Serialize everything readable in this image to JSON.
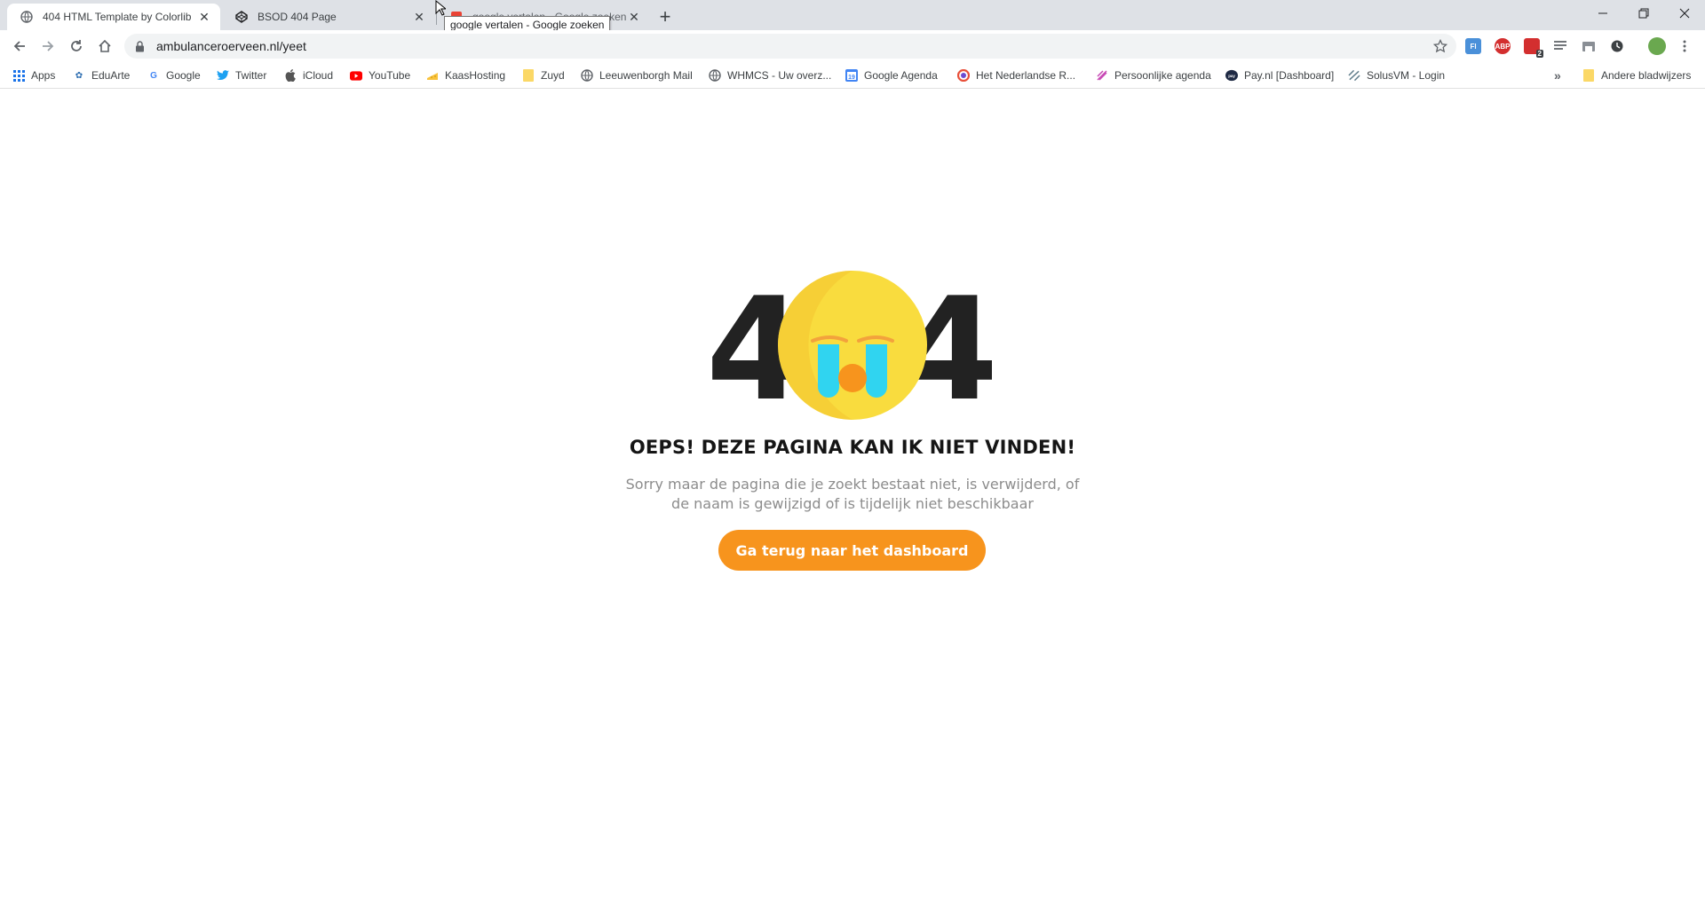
{
  "browser": {
    "tabs": [
      {
        "title": "404 HTML Template by Colorlib",
        "active": true
      },
      {
        "title": "BSOD 404 Page",
        "active": false
      },
      {
        "title": "google vertalen - Google zoeken",
        "active": false
      }
    ],
    "tooltip": "google vertalen - Google zoeken",
    "url": "ambulanceroerveen.nl/yeet",
    "extension_badge": "2",
    "window_controls": {
      "minimize": "–",
      "restore": "❐",
      "close": "✕"
    }
  },
  "bookmarks": {
    "items": [
      {
        "label": "Apps",
        "icon": "apps-grid-icon"
      },
      {
        "label": "EduArte",
        "icon": "eduarte-icon"
      },
      {
        "label": "Google",
        "icon": "google-icon"
      },
      {
        "label": "Twitter",
        "icon": "twitter-icon"
      },
      {
        "label": "iCloud",
        "icon": "apple-icon"
      },
      {
        "label": "YouTube",
        "icon": "youtube-icon"
      },
      {
        "label": "KaasHosting",
        "icon": "cheese-icon"
      },
      {
        "label": "Zuyd",
        "icon": "folder-icon"
      },
      {
        "label": "Leeuwenborgh Mail",
        "icon": "globe-icon"
      },
      {
        "label": "WHMCS - Uw overz...",
        "icon": "globe-icon"
      },
      {
        "label": "Google Agenda",
        "icon": "calendar-icon"
      },
      {
        "label": "Het Nederlandse R...",
        "icon": "red-cross-icon"
      },
      {
        "label": "Persoonlijke agenda",
        "icon": "agenda-icon"
      },
      {
        "label": "Pay.nl [Dashboard]",
        "icon": "paynl-icon"
      },
      {
        "label": "SolusVM - Login",
        "icon": "solusvm-icon"
      }
    ],
    "overflow": "»",
    "other_folder": "Andere bladwijzers"
  },
  "page": {
    "digit_left": "4",
    "digit_right": "4",
    "headline": "OEPS! DEZE PAGINA KAN IK NIET VINDEN!",
    "description": "Sorry maar de pagina die je zoekt bestaat niet, is verwijderd, of de naam is gewijzigd of is tijdelijk niet beschikbaar",
    "button_label": "Ga terug naar het dashboard"
  },
  "colors": {
    "accent": "#f7941d",
    "emoji_face": "#f9dc3e",
    "tears": "#30d4f0",
    "mouth": "#f7941d",
    "digits": "#222222"
  }
}
